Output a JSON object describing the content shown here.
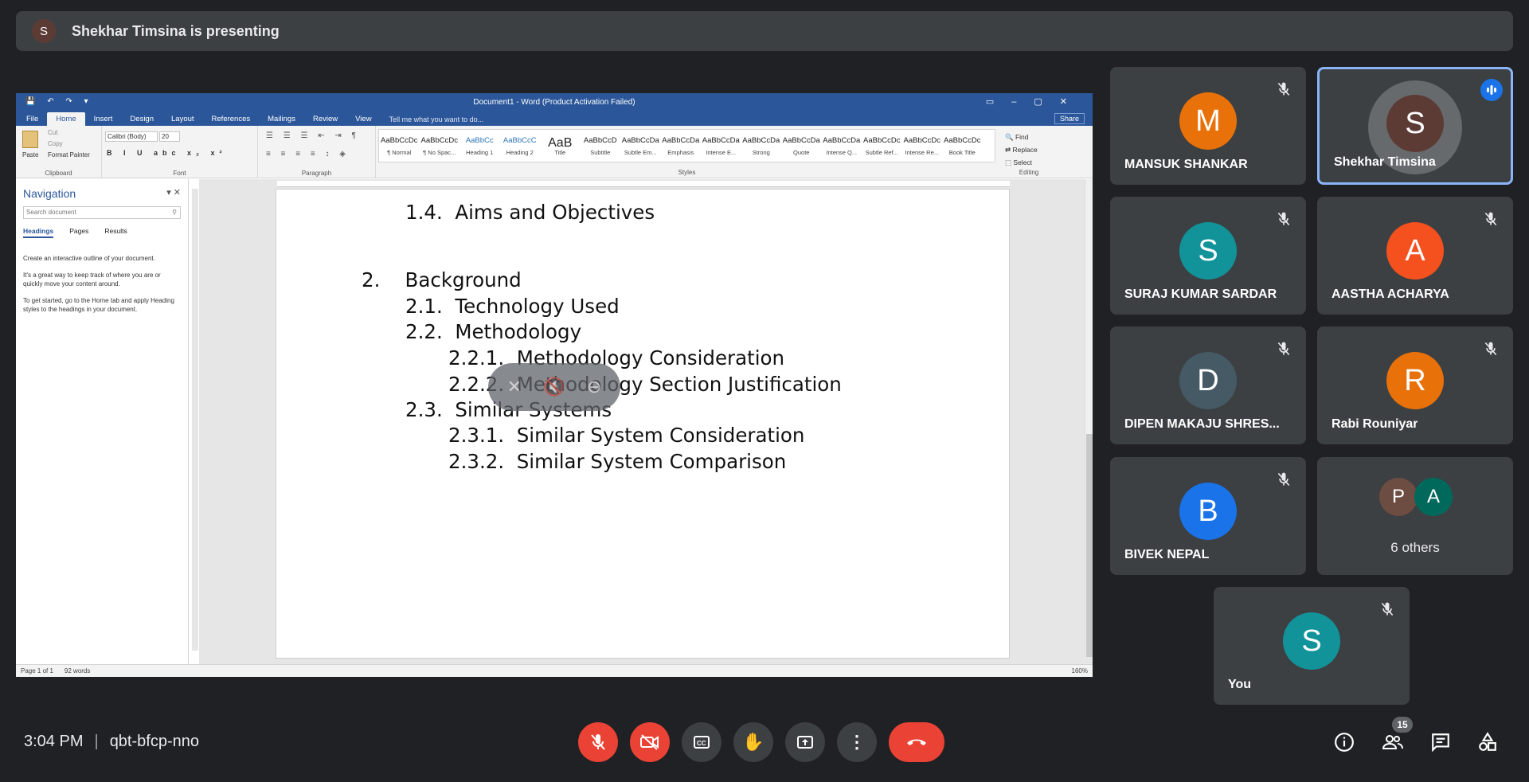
{
  "presenting_banner": {
    "initial": "S",
    "text": "Shekhar Timsina is presenting"
  },
  "word": {
    "title": "Document1 - Word (Product Activation Failed)",
    "tabs": [
      "File",
      "Home",
      "Insert",
      "Design",
      "Layout",
      "References",
      "Mailings",
      "Review",
      "View"
    ],
    "tell_me": "Tell me what you want to do...",
    "share": "Share",
    "clipboard": {
      "paste": "Paste",
      "cut": "Cut",
      "copy": "Copy",
      "format_painter": "Format Painter",
      "label": "Clipboard"
    },
    "font": {
      "name": "Calibri (Body)",
      "size": "20",
      "label": "Font"
    },
    "paragraph_label": "Paragraph",
    "styles_label": "Styles",
    "styles": [
      {
        "sample": "AaBbCcDc",
        "name": "¶ Normal"
      },
      {
        "sample": "AaBbCcDc",
        "name": "¶ No Spac..."
      },
      {
        "sample": "AaBbCc",
        "name": "Heading 1"
      },
      {
        "sample": "AaBbCcC",
        "name": "Heading 2"
      },
      {
        "sample": "AaB",
        "name": "Title"
      },
      {
        "sample": "AaBbCcD",
        "name": "Subtitle"
      },
      {
        "sample": "AaBbCcDa",
        "name": "Subtle Em..."
      },
      {
        "sample": "AaBbCcDa",
        "name": "Emphasis"
      },
      {
        "sample": "AaBbCcDa",
        "name": "Intense E..."
      },
      {
        "sample": "AaBbCcDa",
        "name": "Strong"
      },
      {
        "sample": "AaBbCcDa",
        "name": "Quote"
      },
      {
        "sample": "AaBbCcDa",
        "name": "Intense Q..."
      },
      {
        "sample": "AaBbCcDc",
        "name": "Subtle Ref..."
      },
      {
        "sample": "AaBbCcDc",
        "name": "Intense Re..."
      },
      {
        "sample": "AaBbCcDc",
        "name": "Book Title"
      }
    ],
    "editing": {
      "find": "Find",
      "replace": "Replace",
      "select": "Select",
      "label": "Editing"
    },
    "navigation": {
      "title": "Navigation",
      "search_placeholder": "Search document",
      "tabs": [
        "Headings",
        "Pages",
        "Results"
      ],
      "help": [
        "Create an interactive outline of your document.",
        "It's a great way to keep track of where you are or quickly move your content around.",
        "To get started, go to the Home tab and apply Heading styles to the headings in your document."
      ]
    },
    "document_lines": [
      {
        "num": "1.4.",
        "text": "Aims and Objectives"
      },
      {
        "num": "2.",
        "text": "Background"
      },
      {
        "num": "2.1.",
        "text": "Technology Used"
      },
      {
        "num": "2.2.",
        "text": "Methodology"
      },
      {
        "num": "2.2.1.",
        "text": "Methodology Consideration"
      },
      {
        "num": "2.2.2.",
        "text": "Methodology Section Justification"
      },
      {
        "num": "2.3.",
        "text": "Similar Systems"
      },
      {
        "num": "2.3.1.",
        "text": "Similar System Consideration"
      },
      {
        "num": "2.3.2.",
        "text": "Similar System Comparison"
      }
    ],
    "status": {
      "page": "Page 1 of 1",
      "words": "92 words",
      "zoom": "160%"
    }
  },
  "participants": [
    {
      "name": "MANSUK SHANKAR",
      "initial": "M",
      "color": "#e8710a",
      "muted": true
    },
    {
      "name": "Shekhar Timsina",
      "initial": "S",
      "color": "#5d3b35",
      "muted": false,
      "speaking": true
    },
    {
      "name": "SURAJ KUMAR SARDAR",
      "initial": "S",
      "color": "#12939a",
      "muted": true
    },
    {
      "name": "AASTHA ACHARYA",
      "initial": "A",
      "color": "#f4511e",
      "muted": true
    },
    {
      "name": "DIPEN MAKAJU SHRES...",
      "initial": "D",
      "color": "#455a64",
      "muted": true
    },
    {
      "name": "Rabi Rouniyar",
      "initial": "R",
      "color": "#e8710a",
      "muted": true
    },
    {
      "name": "BIVEK NEPAL",
      "initial": "B",
      "color": "#1a73e8",
      "muted": true
    }
  ],
  "others": {
    "initials": [
      "P",
      "A"
    ],
    "colors": [
      "#6d4c41",
      "#00695c"
    ],
    "label": "6 others"
  },
  "self": {
    "name": "You",
    "initial": "S",
    "color": "#12939a"
  },
  "bottom": {
    "time": "3:04 PM",
    "meeting_code": "qbt-bfcp-nno",
    "people_count": "15"
  }
}
